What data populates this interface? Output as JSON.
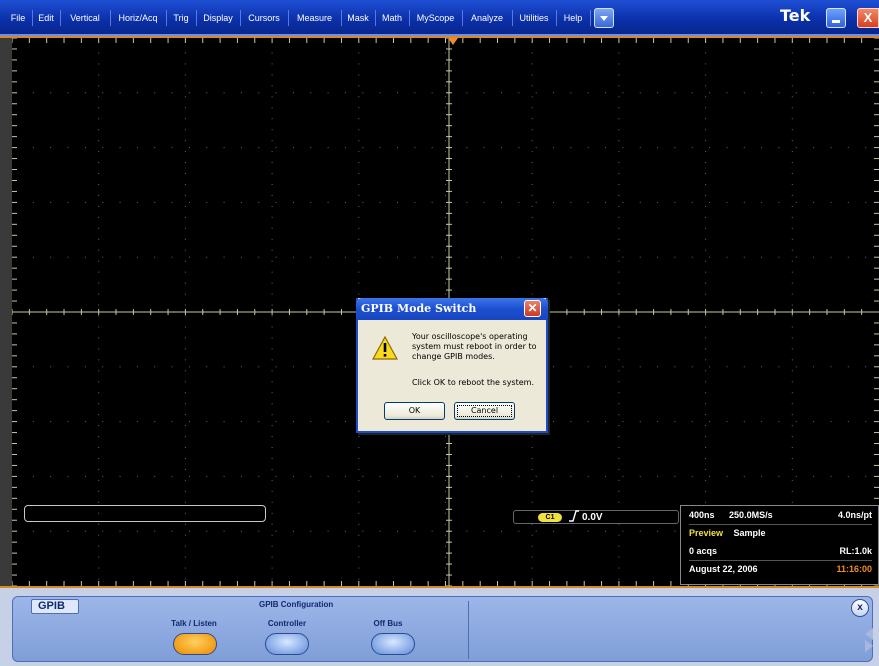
{
  "menu": {
    "items": [
      "File",
      "Edit",
      "Vertical",
      "Horiz/Acq",
      "Trig",
      "Display",
      "Cursors",
      "Measure",
      "Mask",
      "Math",
      "MyScope",
      "Analyze",
      "Utilities",
      "Help"
    ],
    "brand": "Tek",
    "close_glyph": "X"
  },
  "scope": {
    "trigger": {
      "channel_badge": "C1",
      "level": "0.0V"
    },
    "acquisition": {
      "horizontal_scale": "400ns",
      "sample_rate": "250.0MS/s",
      "time_per_point": "4.0ns/pt",
      "mode_state": "Preview",
      "mode": "Sample",
      "acqs": "0 acqs",
      "record_length": "RL:1.0k",
      "date": "August 22, 2006",
      "time": "11:16:00"
    }
  },
  "dialog": {
    "title": "GPIB Mode Switch",
    "close_glyph": "✕",
    "message": "Your oscilloscope's operating system must reboot in order to change GPIB modes.",
    "instruction": "Click OK to reboot the system.",
    "ok_label": "OK",
    "cancel_label": "Cancel"
  },
  "control_panel": {
    "tab_label": "GPIB",
    "heading": "GPIB Configuration",
    "options": [
      {
        "label": "Talk / Listen",
        "selected": true
      },
      {
        "label": "Controller",
        "selected": false
      },
      {
        "label": "Off Bus",
        "selected": false
      }
    ],
    "close_glyph": "x"
  },
  "colors": {
    "menubar": "#1f4fd4",
    "graticule_frame": "#d88a20",
    "selected_option": "#f09810",
    "unselected_option": "#6f98e0",
    "preview_text": "#f0e040",
    "time_text": "#f08a20"
  }
}
